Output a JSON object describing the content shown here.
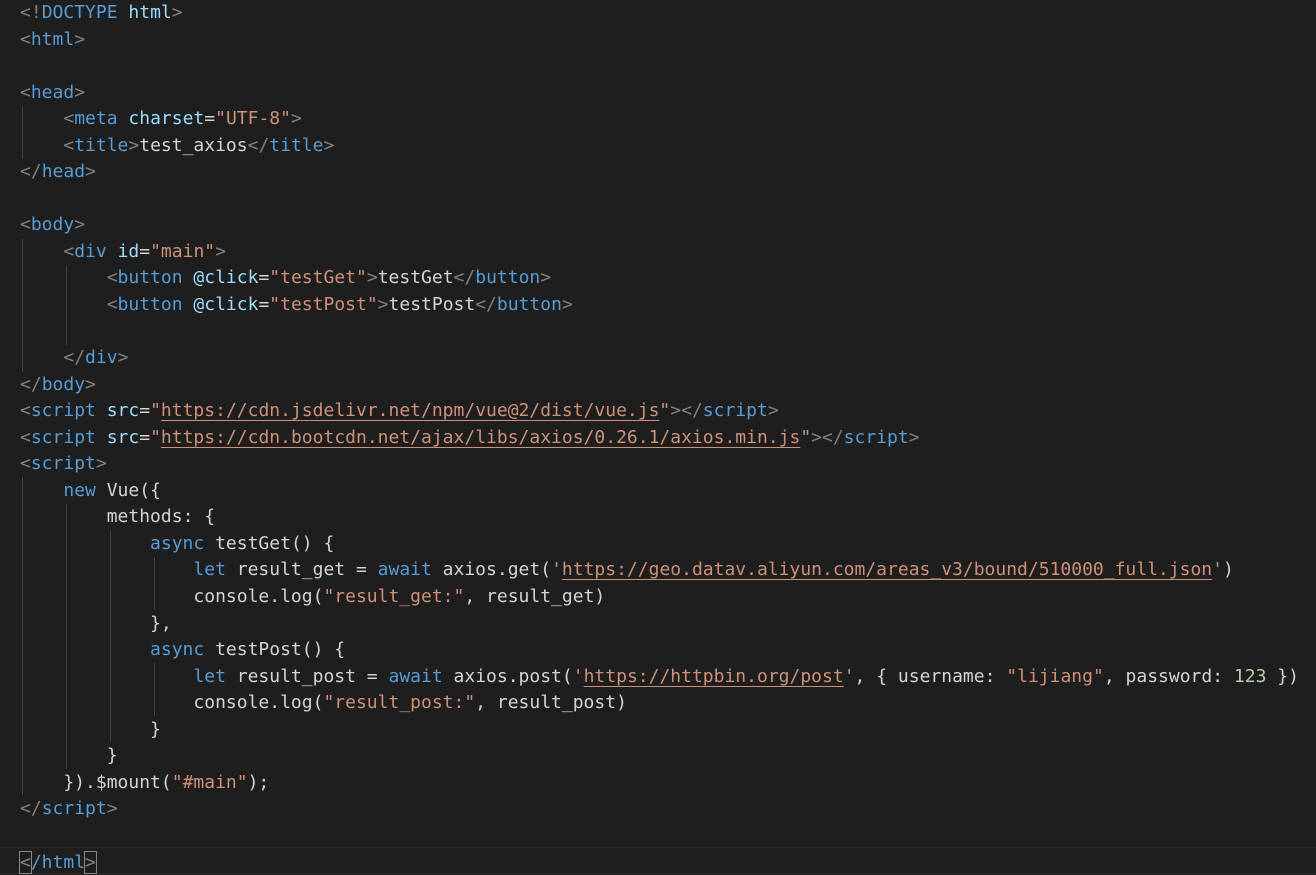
{
  "lines": [
    [
      {
        "c": "t",
        "x": "<!"
      },
      {
        "c": "tg",
        "x": "DOCTYPE"
      },
      {
        "c": "op",
        "x": " "
      },
      {
        "c": "at",
        "x": "html"
      },
      {
        "c": "t",
        "x": ">"
      }
    ],
    [
      {
        "c": "t",
        "x": "<"
      },
      {
        "c": "tg",
        "x": "html"
      },
      {
        "c": "t",
        "x": ">"
      }
    ],
    [],
    [
      {
        "c": "t",
        "x": "<"
      },
      {
        "c": "tg",
        "x": "head"
      },
      {
        "c": "t",
        "x": ">"
      }
    ],
    [
      {
        "c": "op",
        "x": "    "
      },
      {
        "c": "t",
        "x": "<"
      },
      {
        "c": "tg",
        "x": "meta"
      },
      {
        "c": "op",
        "x": " "
      },
      {
        "c": "at",
        "x": "charset"
      },
      {
        "c": "op",
        "x": "="
      },
      {
        "c": "s",
        "x": "\"UTF-8\""
      },
      {
        "c": "t",
        "x": ">"
      }
    ],
    [
      {
        "c": "op",
        "x": "    "
      },
      {
        "c": "t",
        "x": "<"
      },
      {
        "c": "tg",
        "x": "title"
      },
      {
        "c": "t",
        "x": ">"
      },
      {
        "c": "id",
        "x": "test_axios"
      },
      {
        "c": "t",
        "x": "</"
      },
      {
        "c": "tg",
        "x": "title"
      },
      {
        "c": "t",
        "x": ">"
      }
    ],
    [
      {
        "c": "t",
        "x": "</"
      },
      {
        "c": "tg",
        "x": "head"
      },
      {
        "c": "t",
        "x": ">"
      }
    ],
    [],
    [
      {
        "c": "t",
        "x": "<"
      },
      {
        "c": "tg",
        "x": "body"
      },
      {
        "c": "t",
        "x": ">"
      }
    ],
    [
      {
        "c": "op",
        "x": "    "
      },
      {
        "c": "t",
        "x": "<"
      },
      {
        "c": "tg",
        "x": "div"
      },
      {
        "c": "op",
        "x": " "
      },
      {
        "c": "at",
        "x": "id"
      },
      {
        "c": "op",
        "x": "="
      },
      {
        "c": "s",
        "x": "\"main\""
      },
      {
        "c": "t",
        "x": ">"
      }
    ],
    [
      {
        "c": "op",
        "x": "        "
      },
      {
        "c": "t",
        "x": "<"
      },
      {
        "c": "tg",
        "x": "button"
      },
      {
        "c": "op",
        "x": " "
      },
      {
        "c": "at",
        "x": "@click"
      },
      {
        "c": "op",
        "x": "="
      },
      {
        "c": "s",
        "x": "\"testGet\""
      },
      {
        "c": "t",
        "x": ">"
      },
      {
        "c": "id",
        "x": "testGet"
      },
      {
        "c": "t",
        "x": "</"
      },
      {
        "c": "tg",
        "x": "button"
      },
      {
        "c": "t",
        "x": ">"
      }
    ],
    [
      {
        "c": "op",
        "x": "        "
      },
      {
        "c": "t",
        "x": "<"
      },
      {
        "c": "tg",
        "x": "button"
      },
      {
        "c": "op",
        "x": " "
      },
      {
        "c": "at",
        "x": "@click"
      },
      {
        "c": "op",
        "x": "="
      },
      {
        "c": "s",
        "x": "\"testPost\""
      },
      {
        "c": "t",
        "x": ">"
      },
      {
        "c": "id",
        "x": "testPost"
      },
      {
        "c": "t",
        "x": "</"
      },
      {
        "c": "tg",
        "x": "button"
      },
      {
        "c": "t",
        "x": ">"
      }
    ],
    [],
    [
      {
        "c": "op",
        "x": "    "
      },
      {
        "c": "t",
        "x": "</"
      },
      {
        "c": "tg",
        "x": "div"
      },
      {
        "c": "t",
        "x": ">"
      }
    ],
    [
      {
        "c": "t",
        "x": "</"
      },
      {
        "c": "tg",
        "x": "body"
      },
      {
        "c": "t",
        "x": ">"
      }
    ],
    [
      {
        "c": "t",
        "x": "<"
      },
      {
        "c": "tg",
        "x": "script"
      },
      {
        "c": "op",
        "x": " "
      },
      {
        "c": "at",
        "x": "src"
      },
      {
        "c": "op",
        "x": "="
      },
      {
        "c": "s",
        "x": "\""
      },
      {
        "c": "s url",
        "x": "https://cdn.jsdelivr.net/npm/vue@2/dist/vue.js"
      },
      {
        "c": "s",
        "x": "\""
      },
      {
        "c": "t",
        "x": "></"
      },
      {
        "c": "tg",
        "x": "script"
      },
      {
        "c": "t",
        "x": ">"
      }
    ],
    [
      {
        "c": "t",
        "x": "<"
      },
      {
        "c": "tg",
        "x": "script"
      },
      {
        "c": "op",
        "x": " "
      },
      {
        "c": "at",
        "x": "src"
      },
      {
        "c": "op",
        "x": "="
      },
      {
        "c": "s",
        "x": "\""
      },
      {
        "c": "s url",
        "x": "https://cdn.bootcdn.net/ajax/libs/axios/0.26.1/axios.min.js"
      },
      {
        "c": "s",
        "x": "\""
      },
      {
        "c": "t",
        "x": "></"
      },
      {
        "c": "tg",
        "x": "script"
      },
      {
        "c": "t",
        "x": ">"
      }
    ],
    [
      {
        "c": "t",
        "x": "<"
      },
      {
        "c": "tg",
        "x": "script"
      },
      {
        "c": "t",
        "x": ">"
      }
    ],
    [
      {
        "c": "op",
        "x": "    "
      },
      {
        "c": "kw",
        "x": "new"
      },
      {
        "c": "op",
        "x": " "
      },
      {
        "c": "pr",
        "x": "Vue"
      },
      {
        "c": "op",
        "x": "({"
      }
    ],
    [
      {
        "c": "op",
        "x": "        "
      },
      {
        "c": "pr",
        "x": "methods"
      },
      {
        "c": "op",
        "x": ": {"
      }
    ],
    [
      {
        "c": "op",
        "x": "            "
      },
      {
        "c": "kw",
        "x": "async"
      },
      {
        "c": "op",
        "x": " "
      },
      {
        "c": "pr",
        "x": "testGet"
      },
      {
        "c": "op",
        "x": "() {"
      }
    ],
    [
      {
        "c": "op",
        "x": "                "
      },
      {
        "c": "kw",
        "x": "let"
      },
      {
        "c": "op",
        "x": " "
      },
      {
        "c": "id",
        "x": "result_get"
      },
      {
        "c": "op",
        "x": " = "
      },
      {
        "c": "kw",
        "x": "await"
      },
      {
        "c": "op",
        "x": " "
      },
      {
        "c": "id",
        "x": "axios"
      },
      {
        "c": "op",
        "x": "."
      },
      {
        "c": "pr",
        "x": "get"
      },
      {
        "c": "op",
        "x": "("
      },
      {
        "c": "s",
        "x": "'"
      },
      {
        "c": "s url",
        "x": "https://geo.datav.aliyun.com/areas_v3/bound/510000_full.json"
      },
      {
        "c": "s",
        "x": "'"
      },
      {
        "c": "op",
        "x": ")"
      }
    ],
    [
      {
        "c": "op",
        "x": "                "
      },
      {
        "c": "id",
        "x": "console"
      },
      {
        "c": "op",
        "x": "."
      },
      {
        "c": "pr",
        "x": "log"
      },
      {
        "c": "op",
        "x": "("
      },
      {
        "c": "s",
        "x": "\"result_get:\""
      },
      {
        "c": "op",
        "x": ", "
      },
      {
        "c": "id",
        "x": "result_get"
      },
      {
        "c": "op",
        "x": ")"
      }
    ],
    [
      {
        "c": "op",
        "x": "            },"
      }
    ],
    [
      {
        "c": "op",
        "x": "            "
      },
      {
        "c": "kw",
        "x": "async"
      },
      {
        "c": "op",
        "x": " "
      },
      {
        "c": "pr",
        "x": "testPost"
      },
      {
        "c": "op",
        "x": "() {"
      }
    ],
    [
      {
        "c": "op",
        "x": "                "
      },
      {
        "c": "kw",
        "x": "let"
      },
      {
        "c": "op",
        "x": " "
      },
      {
        "c": "id",
        "x": "result_post"
      },
      {
        "c": "op",
        "x": " = "
      },
      {
        "c": "kw",
        "x": "await"
      },
      {
        "c": "op",
        "x": " "
      },
      {
        "c": "id",
        "x": "axios"
      },
      {
        "c": "op",
        "x": "."
      },
      {
        "c": "pr",
        "x": "post"
      },
      {
        "c": "op",
        "x": "("
      },
      {
        "c": "s",
        "x": "'"
      },
      {
        "c": "s url",
        "x": "https://httpbin.org/post"
      },
      {
        "c": "s",
        "x": "'"
      },
      {
        "c": "op",
        "x": ", { "
      },
      {
        "c": "id",
        "x": "username"
      },
      {
        "c": "op",
        "x": ": "
      },
      {
        "c": "s",
        "x": "\"lijiang\""
      },
      {
        "c": "op",
        "x": ", "
      },
      {
        "c": "id",
        "x": "password"
      },
      {
        "c": "op",
        "x": ": "
      },
      {
        "c": "nm",
        "x": "123"
      },
      {
        "c": "op",
        "x": " })"
      }
    ],
    [
      {
        "c": "op",
        "x": "                "
      },
      {
        "c": "id",
        "x": "console"
      },
      {
        "c": "op",
        "x": "."
      },
      {
        "c": "pr",
        "x": "log"
      },
      {
        "c": "op",
        "x": "("
      },
      {
        "c": "s",
        "x": "\"result_post:\""
      },
      {
        "c": "op",
        "x": ", "
      },
      {
        "c": "id",
        "x": "result_post"
      },
      {
        "c": "op",
        "x": ")"
      }
    ],
    [
      {
        "c": "op",
        "x": "            }"
      }
    ],
    [
      {
        "c": "op",
        "x": "        }"
      }
    ],
    [
      {
        "c": "op",
        "x": "    })."
      },
      {
        "c": "pr",
        "x": "$mount"
      },
      {
        "c": "op",
        "x": "("
      },
      {
        "c": "s",
        "x": "\"#main\""
      },
      {
        "c": "op",
        "x": ");"
      }
    ],
    [
      {
        "c": "t",
        "x": "</"
      },
      {
        "c": "tg",
        "x": "script"
      },
      {
        "c": "t",
        "x": ">"
      }
    ],
    [],
    [
      {
        "c": "t bracket-match",
        "x": "<"
      },
      {
        "c": "tg",
        "x": "/html"
      },
      {
        "c": "t bracket-match",
        "x": ">"
      }
    ]
  ]
}
